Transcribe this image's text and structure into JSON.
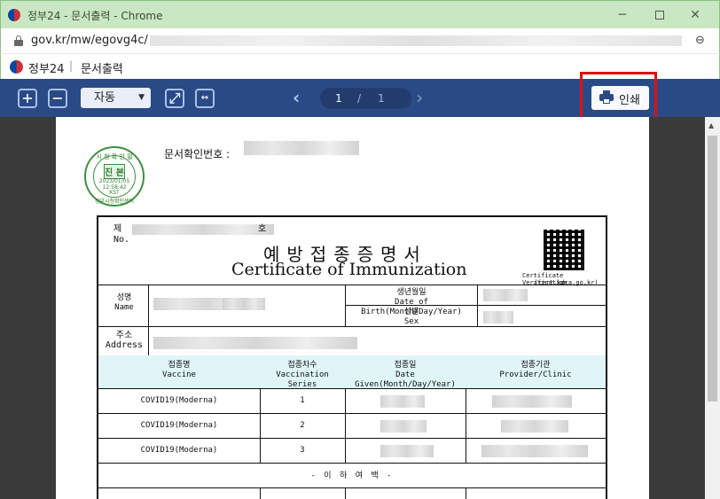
{
  "window": {
    "title": "정부24 - 문서출력 - Chrome",
    "minimize": "─",
    "close": "✕"
  },
  "urlbar": {
    "url": "gov.kr/mw/egovg4c/",
    "zoom_icon": "⊖"
  },
  "site": {
    "brand": "정부24",
    "separator": "|",
    "page_title": "문서출력"
  },
  "toolbar": {
    "zoom_in": "+",
    "zoom_out": "−",
    "zoom_value": "자동",
    "fit_page": "⤢",
    "fit_width": "↔",
    "prev": "‹",
    "current_page": "1",
    "page_sep": "/",
    "total_pages": "1",
    "next": "›",
    "print_label": "인쇄"
  },
  "stamp": {
    "top": "시 청 확 인 필",
    "center": "진 본",
    "date": "2023/01/05",
    "time": "12:58:42",
    "tz": "KST",
    "bottom": "정부시청확인센터"
  },
  "document": {
    "doc_no_label": "문서확인번호 :",
    "cert_no_ko": "제",
    "cert_no_en": "No.",
    "cert_no_suffix": "호",
    "title_ko": "예방접종증명서",
    "title_en": "Certificate of Immunization",
    "qr_caption_1": "Certificate Verification",
    "qr_caption_2": "(cert.kdca.go.kr)",
    "name_ko": "성명",
    "name_en": "Name",
    "dob_ko": "생년월일",
    "dob_en": "Date of Birth(Month/Day/Year)",
    "sex_ko": "성별",
    "sex_en": "Sex",
    "address_ko": "주소",
    "address_en": "Address",
    "columns": [
      {
        "ko": "접종명",
        "en": "Vaccine"
      },
      {
        "ko": "접종차수",
        "en": "Vaccination Series"
      },
      {
        "ko": "접종일",
        "en": "Date Given(Month/Day/Year)"
      },
      {
        "ko": "접종기관",
        "en": "Provider/Clinic"
      }
    ],
    "rows": [
      {
        "vaccine": "COVID19(Moderna)",
        "series": "1"
      },
      {
        "vaccine": "COVID19(Moderna)",
        "series": "2"
      },
      {
        "vaccine": "COVID19(Moderna)",
        "series": "3"
      }
    ],
    "end_mark": "- 이 하 여 백 -"
  }
}
